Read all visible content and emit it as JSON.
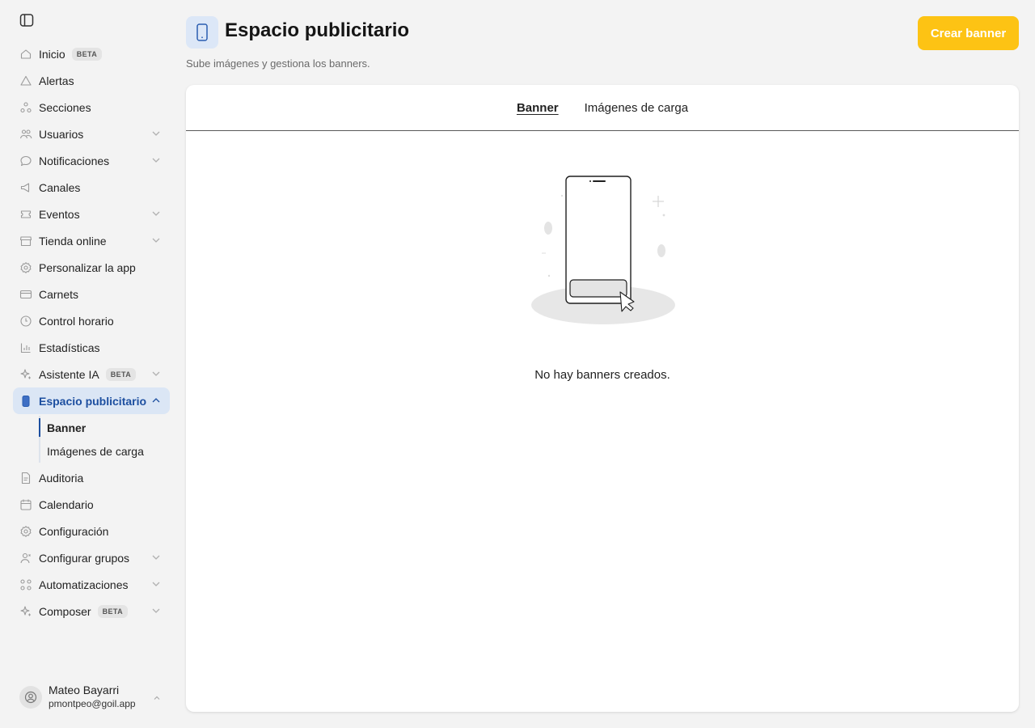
{
  "sidebar": {
    "toggle_icon": "sidebar-toggle-icon",
    "items": [
      {
        "label": "Inicio",
        "icon": "home-icon",
        "badge": "BETA"
      },
      {
        "label": "Alertas",
        "icon": "alert-triangle-icon"
      },
      {
        "label": "Secciones",
        "icon": "sections-icon"
      },
      {
        "label": "Usuarios",
        "icon": "users-icon",
        "expandable": true
      },
      {
        "label": "Notificaciones",
        "icon": "chat-bubble-icon",
        "expandable": true
      },
      {
        "label": "Canales",
        "icon": "megaphone-icon"
      },
      {
        "label": "Eventos",
        "icon": "ticket-icon",
        "expandable": true
      },
      {
        "label": "Tienda online",
        "icon": "store-icon",
        "expandable": true
      },
      {
        "label": "Personalizar la app",
        "icon": "gear-icon"
      },
      {
        "label": "Carnets",
        "icon": "card-icon"
      },
      {
        "label": "Control horario",
        "icon": "clock-icon"
      },
      {
        "label": "Estadísticas",
        "icon": "bar-chart-icon"
      },
      {
        "label": "Asistente IA",
        "icon": "sparkle-icon",
        "badge": "BETA",
        "expandable": true
      },
      {
        "label": "Espacio publicitario",
        "icon": "phone-icon",
        "expanded": true,
        "active": true,
        "children": [
          {
            "label": "Banner",
            "active": true
          },
          {
            "label": "Imágenes de carga"
          }
        ]
      },
      {
        "label": "Auditoria",
        "icon": "document-icon"
      },
      {
        "label": "Calendario",
        "icon": "calendar-icon"
      },
      {
        "label": "Configuración",
        "icon": "gear-icon"
      },
      {
        "label": "Configurar grupos",
        "icon": "user-group-icon",
        "expandable": true
      },
      {
        "label": "Automatizaciones",
        "icon": "automation-icon",
        "expandable": true
      },
      {
        "label": "Composer",
        "icon": "sparkle-icon",
        "badge": "BETA",
        "expandable": true
      }
    ]
  },
  "user": {
    "name": "Mateo Bayarri",
    "email": "pmontpeo@goil.app"
  },
  "header": {
    "title": "Espacio publicitario",
    "subtitle": "Sube imágenes y gestiona los banners.",
    "create_label": "Crear banner"
  },
  "tabs": [
    {
      "label": "Banner",
      "active": true
    },
    {
      "label": "Imágenes de carga"
    }
  ],
  "empty_state": {
    "message": "No hay banners creados."
  },
  "colors": {
    "accent": "#fdc314",
    "active_bg": "#dbe6f5",
    "active_text": "#1d4fa0",
    "background": "#f3f3f3"
  }
}
